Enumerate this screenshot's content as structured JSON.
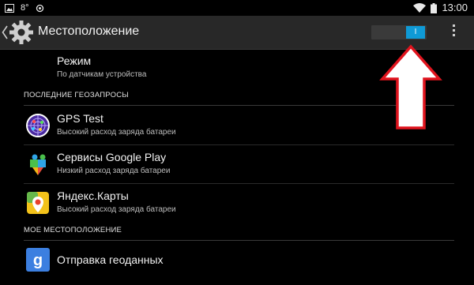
{
  "statusbar": {
    "icons": [
      "image-icon",
      "temperature-badge",
      "refresh-icon",
      "wifi-icon",
      "battery-icon"
    ],
    "badge_text": "8°",
    "time": "13:00"
  },
  "actionbar": {
    "title": "Местоположение",
    "toggle_label": "I",
    "toggle_state": "on",
    "accent": "#0f9ad6"
  },
  "mode": {
    "title": "Режим",
    "subtitle": "По датчикам устройства"
  },
  "sections": {
    "recent": "ПОСЛЕДНИЕ ГЕОЗАПРОСЫ",
    "my_location": "МОЕ МЕСТОПОЛОЖЕНИЕ"
  },
  "recent_apps": [
    {
      "name": "GPS Test",
      "usage": "Высокий расход заряда батареи",
      "icon": "gps-test-icon"
    },
    {
      "name": "Сервисы Google Play",
      "usage": "Низкий расход заряда батареи",
      "icon": "google-play-icon"
    },
    {
      "name": "Яндекс.Карты",
      "usage": "Высокий расход заряда батареи",
      "icon": "yandex-maps-icon"
    }
  ],
  "my_location_items": [
    {
      "name": "Отправка геоданных",
      "icon": "google-g-icon"
    }
  ],
  "annotation": {
    "color": "#e0141e",
    "type": "arrow-up"
  }
}
